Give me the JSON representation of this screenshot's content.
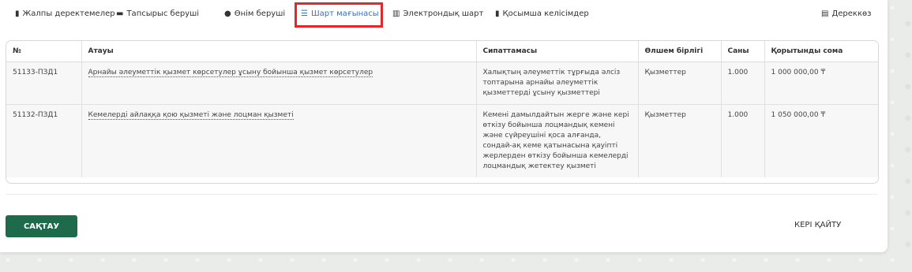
{
  "tabs": [
    {
      "label": "Жалпы деректемелер",
      "icon": "document-icon"
    },
    {
      "label": "Тапсырыс беруші",
      "icon": "briefcase-icon"
    },
    {
      "label": "Өнім беруші",
      "icon": "user-icon"
    },
    {
      "label": "Шарт мағынасы",
      "icon": "list-icon",
      "active": true
    },
    {
      "label": "Электрондық шарт",
      "icon": "barcode-icon"
    },
    {
      "label": "Қосымша келісімдер",
      "icon": "file-icon"
    },
    {
      "label": "Дереккөз",
      "icon": "database-icon"
    }
  ],
  "table": {
    "headers": [
      "№",
      "Атауы",
      "Сипаттамасы",
      "Өлшем бірлігі",
      "Саны",
      "Қорытынды сома"
    ],
    "rows": [
      {
        "code": "51133-ПЗД1",
        "name": "Арнайы әлеуметтік қызмет көрсетулер ұсыну бойынша қызмет көрсетулер",
        "description": "Халықтың әлеуметтік тұрғыда әлсіз топтарына арнайы әлеуметтік қызметтерді ұсыну қызметтері",
        "unit": "Қызметтер",
        "qty": "1.000",
        "total": "1 000 000,00 ₸"
      },
      {
        "code": "51132-ПЗД1",
        "name": "Кемелерді айлаққа қою қызметі және лоцман қызметі",
        "description": "Кемені дамылдайтын жерге және кері өткізу бойынша лоцмандық кемені және сүйреушіні қоса алғанда, сондай-ақ кеме қатынасына қауіпті жерлерден өткізу бойынша кемелерді лоцмандық жетектеу қызметі",
        "unit": "Қызметтер",
        "qty": "1.000",
        "total": "1 050 000,00 ₸"
      }
    ]
  },
  "actions": {
    "save_label": "САҚТАУ",
    "back_label": "КЕРІ ҚАЙТУ"
  },
  "colors": {
    "accent": "#2d6fd3",
    "save_button": "#1d6b4a",
    "highlight": "#e2262a"
  }
}
